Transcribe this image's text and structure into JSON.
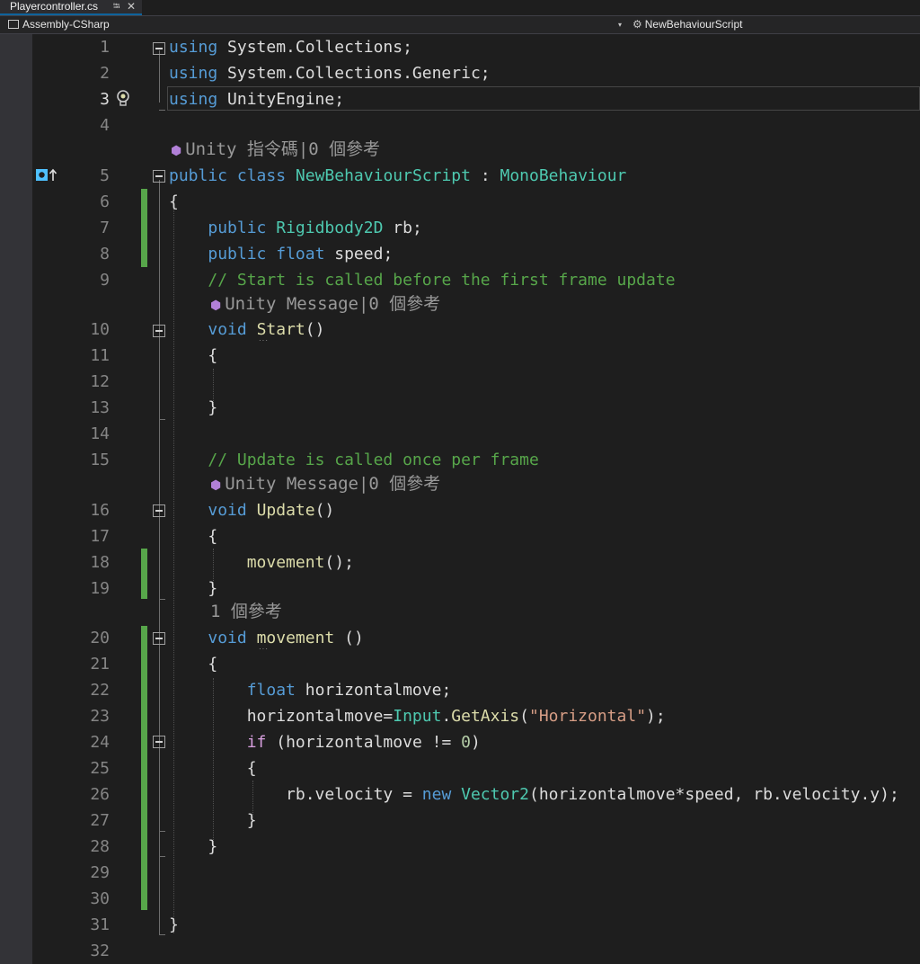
{
  "tab": {
    "label": "Playercontroller.cs",
    "pin": "⭾",
    "close": "✕"
  },
  "nav": {
    "left_label": "Assembly-CSharp",
    "dropdown": "▾",
    "right_label": "NewBehaviourScript"
  },
  "lens": {
    "class_refs": "Unity 指令碼|0 個參考",
    "start_refs": "Unity Message|0 個參考",
    "update_refs": "Unity Message|0 個參考",
    "movement_refs": "1 個參考"
  },
  "colors": {
    "keyword": "#569cd6",
    "type": "#4ec9b0",
    "comment": "#57a64a",
    "string": "#d69d85",
    "method": "#dcdcaa",
    "control": "#d8a0df",
    "number": "#b5cea8",
    "change_bar": "#57a64a"
  },
  "current_line": "3",
  "lines": [
    {
      "n": "1",
      "tokens": [
        {
          "t": "using",
          "c": "kw"
        },
        {
          "t": " System.Collections;"
        }
      ]
    },
    {
      "n": "2",
      "tokens": [
        {
          "t": "using",
          "c": "kw"
        },
        {
          "t": " System.Collections.Generic;"
        }
      ]
    },
    {
      "n": "3",
      "tokens": [
        {
          "t": "using",
          "c": "kw"
        },
        {
          "t": " UnityEngine;"
        }
      ]
    },
    {
      "n": "4",
      "tokens": []
    },
    {
      "n": "5",
      "tokens": [
        {
          "t": "public",
          "c": "kw"
        },
        {
          "t": " "
        },
        {
          "t": "class",
          "c": "kw"
        },
        {
          "t": " "
        },
        {
          "t": "NewBehaviourScript",
          "c": "ty"
        },
        {
          "t": " : "
        },
        {
          "t": "MonoBehaviour",
          "c": "ty"
        }
      ]
    },
    {
      "n": "6",
      "tokens": [
        {
          "t": "{"
        }
      ]
    },
    {
      "n": "7",
      "tokens": [
        {
          "t": "    "
        },
        {
          "t": "public",
          "c": "kw"
        },
        {
          "t": " "
        },
        {
          "t": "Rigidbody2D",
          "c": "ty"
        },
        {
          "t": " rb;"
        }
      ]
    },
    {
      "n": "8",
      "tokens": [
        {
          "t": "    "
        },
        {
          "t": "public",
          "c": "kw"
        },
        {
          "t": " "
        },
        {
          "t": "float",
          "c": "kw"
        },
        {
          "t": " speed;"
        }
      ]
    },
    {
      "n": "9",
      "tokens": [
        {
          "t": "    "
        },
        {
          "t": "// Start is called before the first frame update",
          "c": "cm"
        }
      ]
    },
    {
      "n": "10",
      "tokens": [
        {
          "t": "    "
        },
        {
          "t": "void",
          "c": "kw"
        },
        {
          "t": " "
        },
        {
          "t": "Start",
          "c": "fn"
        },
        {
          "t": "()"
        }
      ]
    },
    {
      "n": "11",
      "tokens": [
        {
          "t": "    {"
        }
      ]
    },
    {
      "n": "12",
      "tokens": []
    },
    {
      "n": "13",
      "tokens": [
        {
          "t": "    }"
        }
      ]
    },
    {
      "n": "14",
      "tokens": []
    },
    {
      "n": "15",
      "tokens": [
        {
          "t": "    "
        },
        {
          "t": "// Update is called once per frame",
          "c": "cm"
        }
      ]
    },
    {
      "n": "16",
      "tokens": [
        {
          "t": "    "
        },
        {
          "t": "void",
          "c": "kw"
        },
        {
          "t": " "
        },
        {
          "t": "Update",
          "c": "fn"
        },
        {
          "t": "()"
        }
      ]
    },
    {
      "n": "17",
      "tokens": [
        {
          "t": "    {"
        }
      ]
    },
    {
      "n": "18",
      "tokens": [
        {
          "t": "        "
        },
        {
          "t": "movement",
          "c": "fn"
        },
        {
          "t": "();"
        }
      ]
    },
    {
      "n": "19",
      "tokens": [
        {
          "t": "    }"
        }
      ]
    },
    {
      "n": "20",
      "tokens": [
        {
          "t": "    "
        },
        {
          "t": "void",
          "c": "kw"
        },
        {
          "t": " "
        },
        {
          "t": "movement",
          "c": "fn"
        },
        {
          "t": " ()"
        }
      ]
    },
    {
      "n": "21",
      "tokens": [
        {
          "t": "    {"
        }
      ]
    },
    {
      "n": "22",
      "tokens": [
        {
          "t": "        "
        },
        {
          "t": "float",
          "c": "kw"
        },
        {
          "t": " horizontalmove;"
        }
      ]
    },
    {
      "n": "23",
      "tokens": [
        {
          "t": "        horizontalmove="
        },
        {
          "t": "Input",
          "c": "ty"
        },
        {
          "t": "."
        },
        {
          "t": "GetAxis",
          "c": "fn"
        },
        {
          "t": "("
        },
        {
          "t": "\"Horizontal\"",
          "c": "st"
        },
        {
          "t": ");"
        }
      ]
    },
    {
      "n": "24",
      "tokens": [
        {
          "t": "        "
        },
        {
          "t": "if",
          "c": "ctl"
        },
        {
          "t": " (horizontalmove != "
        },
        {
          "t": "0",
          "c": "num"
        },
        {
          "t": ")"
        }
      ]
    },
    {
      "n": "25",
      "tokens": [
        {
          "t": "        {"
        }
      ]
    },
    {
      "n": "26",
      "tokens": [
        {
          "t": "            rb.velocity = "
        },
        {
          "t": "new",
          "c": "kw"
        },
        {
          "t": " "
        },
        {
          "t": "Vector2",
          "c": "ty"
        },
        {
          "t": "(horizontalmove*speed, rb.velocity.y);"
        }
      ]
    },
    {
      "n": "27",
      "tokens": [
        {
          "t": "        }"
        }
      ]
    },
    {
      "n": "28",
      "tokens": [
        {
          "t": "    }"
        }
      ]
    },
    {
      "n": "29",
      "tokens": []
    },
    {
      "n": "30",
      "tokens": []
    },
    {
      "n": "31",
      "tokens": [
        {
          "t": "}"
        }
      ]
    },
    {
      "n": "32",
      "tokens": []
    }
  ]
}
